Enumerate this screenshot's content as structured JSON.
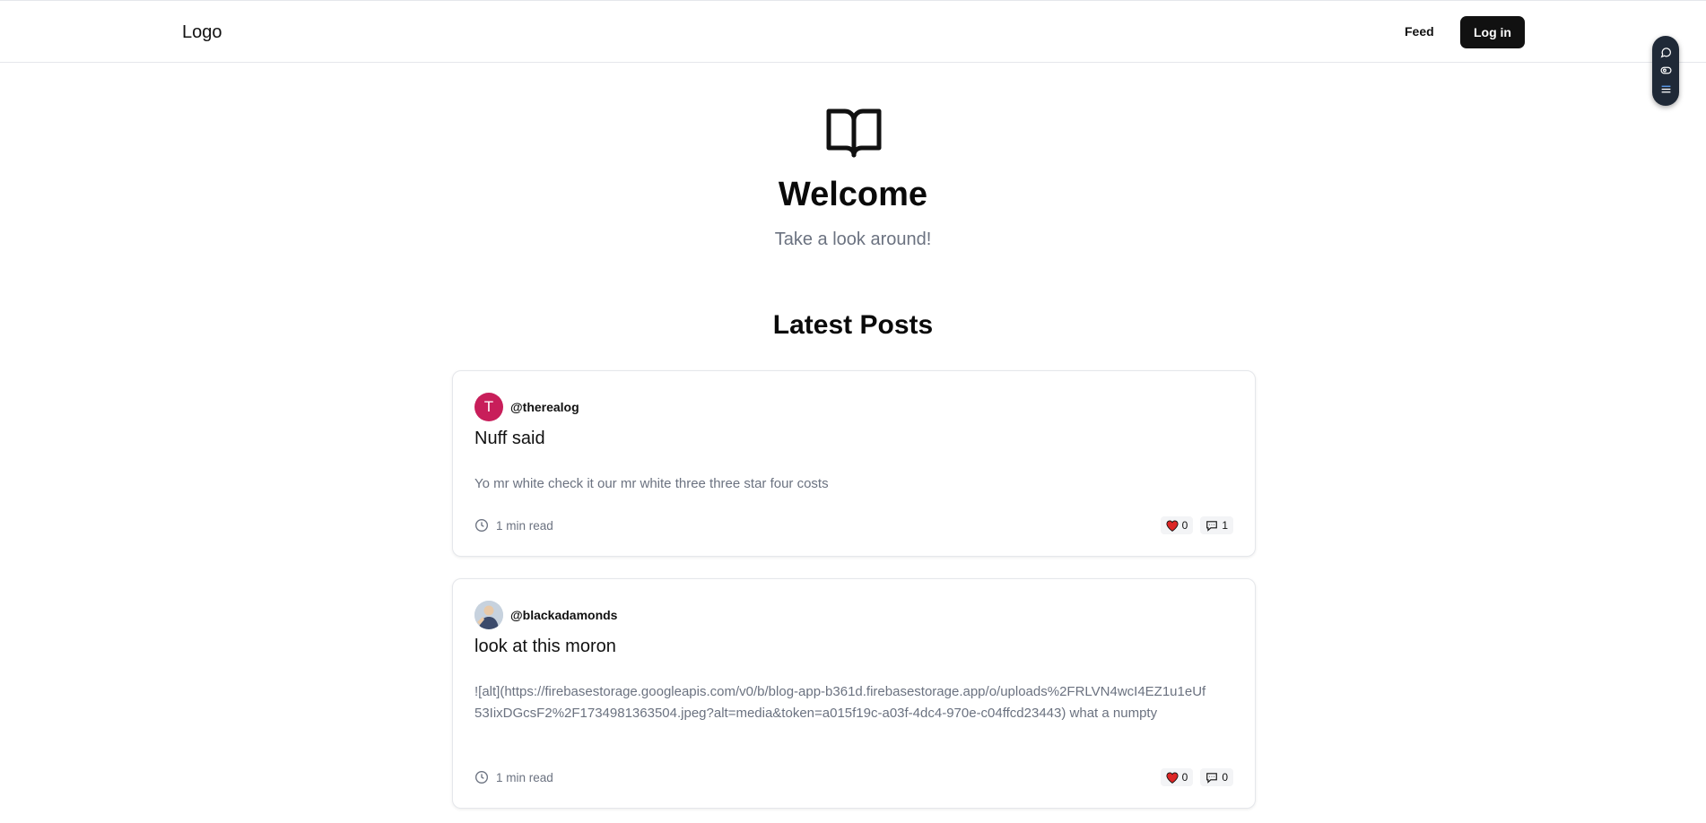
{
  "header": {
    "logo": "Logo",
    "nav_feed": "Feed",
    "login_label": "Log in"
  },
  "side_tools": [
    "chat-bubble-icon",
    "eye-icon",
    "list-icon"
  ],
  "hero": {
    "icon": "open-book-icon",
    "title": "Welcome",
    "subtitle": "Take a look around!"
  },
  "latest": {
    "heading": "Latest Posts",
    "posts": [
      {
        "avatar_letter": "T",
        "avatar_color": "#c81e5a",
        "handle": "@therealog",
        "title": "Nuff said",
        "body": "Yo mr white check it our mr white three three star four costs",
        "read_time": "1 min read",
        "likes": "0",
        "comments": "1"
      },
      {
        "avatar_letter": "",
        "handle": "@blackadamonds",
        "title": "look at this moron",
        "body": "![alt](https://firebasestorage.googleapis.com/v0/b/blog-app-b361d.firebasestorage.app/o/uploads%2FRLVN4wcI4EZ1u1eUf53IixDGcsF2%2F1734981363504.jpeg?alt=media&token=a015f19c-a03f-4dc4-970e-c04ffcd23443) what a numpty",
        "read_time": "1 min read",
        "likes": "0",
        "comments": "0"
      }
    ]
  },
  "colors": {
    "like_heart": "#dc2626",
    "button_dark": "#111111",
    "muted_text": "#6b7280"
  }
}
